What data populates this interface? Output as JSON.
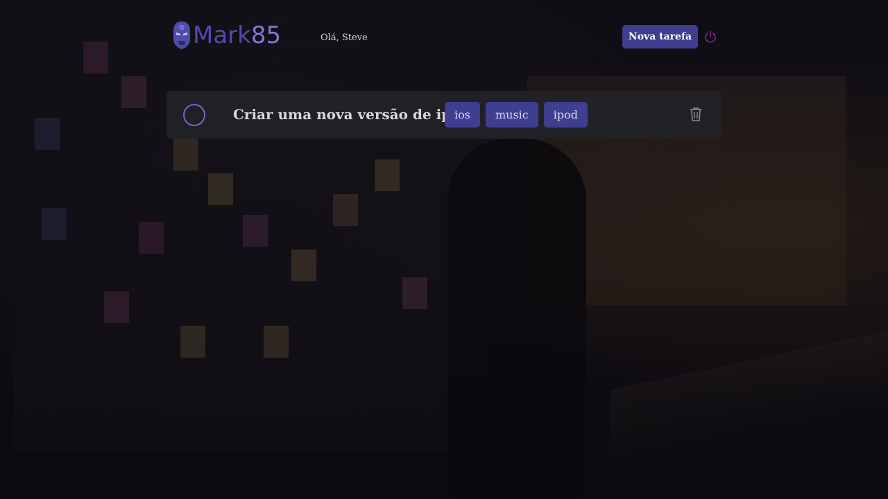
{
  "header": {
    "logo_text": "Mark",
    "logo_number": "85",
    "greeting": "Olá, Steve",
    "new_task_label": "Nova tarefa"
  },
  "icons": {
    "logo": "iron-man-helmet-icon",
    "logout": "power-icon",
    "checkbox": "circle-icon",
    "delete": "trash-icon"
  },
  "colors": {
    "accent": "#3f3e91",
    "logo_primary": "#4f4cab",
    "logout_icon": "#8a2a86",
    "checkbox_border": "#6d69d8",
    "card_background": "#222126"
  },
  "tasks": [
    {
      "title": "Criar uma nova versão de ipod",
      "done": false,
      "tags": [
        "ios",
        "music",
        "ipod"
      ]
    }
  ]
}
